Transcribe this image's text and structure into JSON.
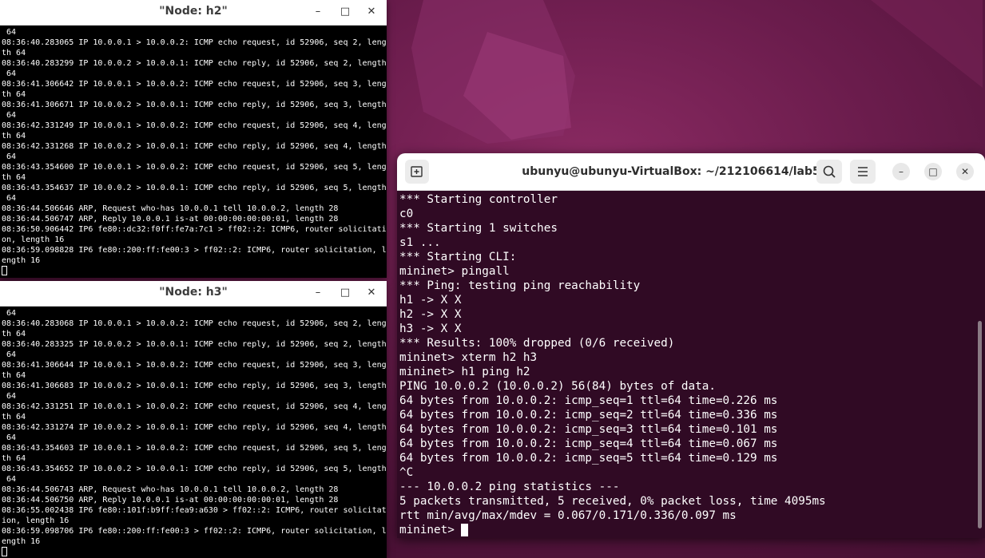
{
  "xterm_h2": {
    "title": "\"Node: h2\"",
    "lines": [
      " 64",
      "08:36:40.283065 IP 10.0.0.1 > 10.0.0.2: ICMP echo request, id 52906, seq 2, leng",
      "th 64",
      "08:36:40.283299 IP 10.0.0.2 > 10.0.0.1: ICMP echo reply, id 52906, seq 2, length",
      " 64",
      "08:36:41.306642 IP 10.0.0.1 > 10.0.0.2: ICMP echo request, id 52906, seq 3, leng",
      "th 64",
      "08:36:41.306671 IP 10.0.0.2 > 10.0.0.1: ICMP echo reply, id 52906, seq 3, length",
      " 64",
      "08:36:42.331249 IP 10.0.0.1 > 10.0.0.2: ICMP echo request, id 52906, seq 4, leng",
      "th 64",
      "08:36:42.331268 IP 10.0.0.2 > 10.0.0.1: ICMP echo reply, id 52906, seq 4, length",
      " 64",
      "08:36:43.354600 IP 10.0.0.1 > 10.0.0.2: ICMP echo request, id 52906, seq 5, leng",
      "th 64",
      "08:36:43.354637 IP 10.0.0.2 > 10.0.0.1: ICMP echo reply, id 52906, seq 5, length",
      " 64",
      "08:36:44.506646 ARP, Request who-has 10.0.0.1 tell 10.0.0.2, length 28",
      "08:36:44.506747 ARP, Reply 10.0.0.1 is-at 00:00:00:00:00:01, length 28",
      "08:36:50.906442 IP6 fe80::dc32:f0ff:fe7a:7c1 > ff02::2: ICMP6, router solicitati",
      "on, length 16",
      "08:36:59.098828 IP6 fe80::200:ff:fe00:3 > ff02::2: ICMP6, router solicitation, l",
      "ength 16"
    ]
  },
  "xterm_h3": {
    "title": "\"Node: h3\"",
    "lines": [
      " 64",
      "08:36:40.283068 IP 10.0.0.1 > 10.0.0.2: ICMP echo request, id 52906, seq 2, leng",
      "th 64",
      "08:36:40.283325 IP 10.0.0.2 > 10.0.0.1: ICMP echo reply, id 52906, seq 2, length",
      " 64",
      "08:36:41.306644 IP 10.0.0.1 > 10.0.0.2: ICMP echo request, id 52906, seq 3, leng",
      "th 64",
      "08:36:41.306683 IP 10.0.0.2 > 10.0.0.1: ICMP echo reply, id 52906, seq 3, length",
      " 64",
      "08:36:42.331251 IP 10.0.0.1 > 10.0.0.2: ICMP echo request, id 52906, seq 4, leng",
      "th 64",
      "08:36:42.331274 IP 10.0.0.2 > 10.0.0.1: ICMP echo reply, id 52906, seq 4, length",
      " 64",
      "08:36:43.354603 IP 10.0.0.1 > 10.0.0.2: ICMP echo request, id 52906, seq 5, leng",
      "th 64",
      "08:36:43.354652 IP 10.0.0.2 > 10.0.0.1: ICMP echo reply, id 52906, seq 5, length",
      " 64",
      "08:36:44.506743 ARP, Request who-has 10.0.0.1 tell 10.0.0.2, length 28",
      "08:36:44.506750 ARP, Reply 10.0.0.1 is-at 00:00:00:00:00:01, length 28",
      "08:36:55.002438 IP6 fe80::101f:b9ff:fea9:a630 > ff02::2: ICMP6, router solicitat",
      "ion, length 16",
      "08:36:59.098706 IP6 fe80::200:ff:fe00:3 > ff02::2: ICMP6, router solicitation, l",
      "ength 16"
    ]
  },
  "terminal": {
    "title": "ubunyu@ubunyu-VirtualBox: ~/212106614/lab5",
    "prompt": "mininet> ",
    "lines": [
      "*** Starting controller",
      "c0",
      "*** Starting 1 switches",
      "s1 ...",
      "*** Starting CLI:",
      "mininet> pingall",
      "*** Ping: testing ping reachability",
      "h1 -> X X",
      "h2 -> X X",
      "h3 -> X X",
      "*** Results: 100% dropped (0/6 received)",
      "mininet> xterm h2 h3",
      "mininet> h1 ping h2",
      "PING 10.0.0.2 (10.0.0.2) 56(84) bytes of data.",
      "64 bytes from 10.0.0.2: icmp_seq=1 ttl=64 time=0.226 ms",
      "64 bytes from 10.0.0.2: icmp_seq=2 ttl=64 time=0.336 ms",
      "64 bytes from 10.0.0.2: icmp_seq=3 ttl=64 time=0.101 ms",
      "64 bytes from 10.0.0.2: icmp_seq=4 ttl=64 time=0.067 ms",
      "64 bytes from 10.0.0.2: icmp_seq=5 ttl=64 time=0.129 ms",
      "^C",
      "--- 10.0.0.2 ping statistics ---",
      "5 packets transmitted, 5 received, 0% packet loss, time 4095ms",
      "rtt min/avg/max/mdev = 0.067/0.171/0.336/0.097 ms"
    ]
  },
  "icons": {
    "minimize": "minimize-icon",
    "maximize": "maximize-icon",
    "close": "close-icon",
    "new_tab": "new-tab-icon",
    "search": "search-icon",
    "menu": "hamburger-menu-icon"
  },
  "colors": {
    "terminal_bg": "#300a24",
    "xterm_bg": "#000000",
    "wallpaper": "#6a1c4c"
  }
}
